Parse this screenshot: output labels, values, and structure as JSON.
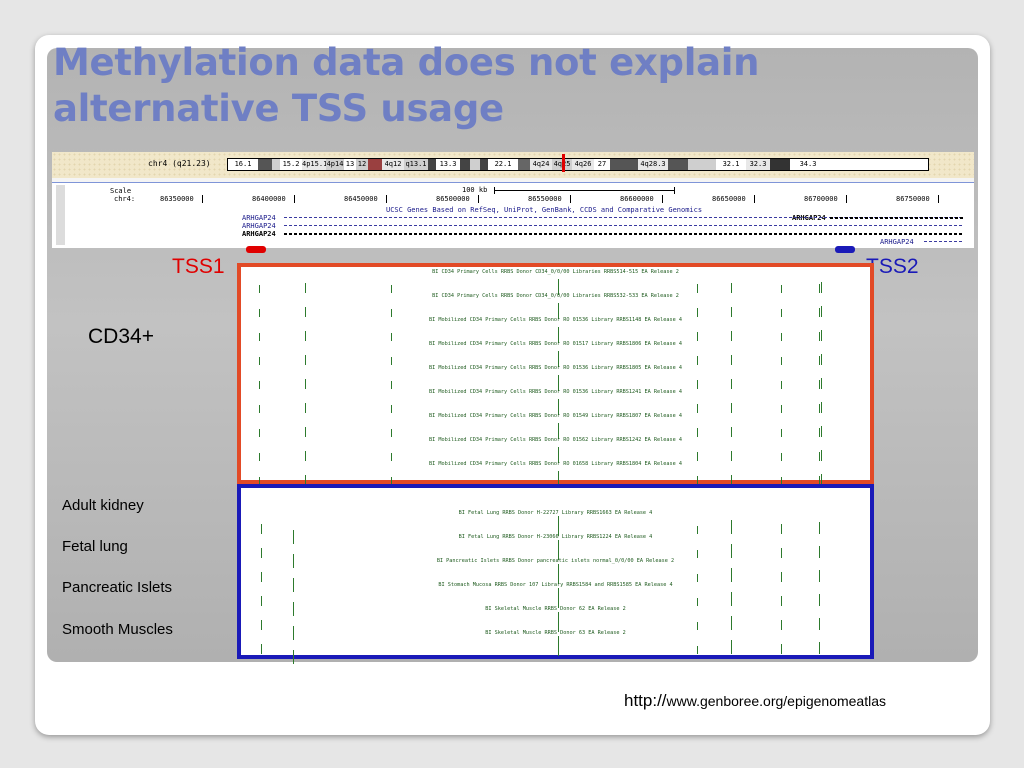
{
  "slide": {
    "title_line1": "Methylation data does not explain",
    "title_line2": "alternative TSS usage",
    "url_proto": "http://",
    "url_rest": "www.genboree.org/epigenomeatlas"
  },
  "browser": {
    "chrom_label": "chr4 (q21.23)",
    "bands": [
      {
        "label": "16.1",
        "color": "#ffffff"
      },
      {
        "label": "",
        "color": "#555555"
      },
      {
        "label": "",
        "color": "#cfcfcf"
      },
      {
        "label": "15.2",
        "color": "#ffffff"
      },
      {
        "label": "4p15.1",
        "color": "#e8e8e8"
      },
      {
        "label": "4p14",
        "color": "#cfcfcf"
      },
      {
        "label": "13",
        "color": "#ffffff"
      },
      {
        "label": "12",
        "color": "#cfcfcf"
      },
      {
        "label": "",
        "color": "#9a4040"
      },
      {
        "label": "4q12",
        "color": "#e8e8e8"
      },
      {
        "label": "q13.1",
        "color": "#cfcfcf"
      },
      {
        "label": "",
        "color": "#444444"
      },
      {
        "label": "13.3",
        "color": "#ffffff"
      },
      {
        "label": "",
        "color": "#444444"
      },
      {
        "label": "",
        "color": "#cfcfcf"
      },
      {
        "label": "",
        "color": "#444444"
      },
      {
        "label": "22.1",
        "color": "#ffffff"
      },
      {
        "label": "",
        "color": "#666666"
      },
      {
        "label": "4q24",
        "color": "#e8e8e8"
      },
      {
        "label": "4q25",
        "color": "#cfcfcf"
      },
      {
        "label": "4q26",
        "color": "#e8e8e8"
      },
      {
        "label": "27",
        "color": "#ffffff"
      },
      {
        "label": "",
        "color": "#555555"
      },
      {
        "label": "4q28.3",
        "color": "#e8e8e8"
      },
      {
        "label": "",
        "color": "#555555"
      },
      {
        "label": "",
        "color": "#cfcfcf"
      },
      {
        "label": "32.1",
        "color": "#ffffff"
      },
      {
        "label": "32.3",
        "color": "#e8e8e8"
      },
      {
        "label": "",
        "color": "#333333"
      },
      {
        "label": "34.3",
        "color": "#ffffff"
      }
    ],
    "scale_label": "Scale",
    "chr_label": "chr4:",
    "scale_value": "100 kb",
    "coordinates": [
      "86350000",
      "86400000",
      "86450000",
      "86500000",
      "86550000",
      "86600000",
      "86650000",
      "86700000",
      "86750000"
    ],
    "track_title": "UCSC Genes Based on RefSeq, UniProt, GenBank, CCDS and Comparative Genomics",
    "gene_names": [
      "ARHGAP24",
      "ARHGAP24",
      "ARHGAP24",
      "ARHGAP24",
      "ARHGAP24"
    ]
  },
  "tss": {
    "tss1": "TSS1",
    "tss2": "TSS2",
    "tss1_color": "#e00000",
    "tss2_color": "#1a1ab8"
  },
  "cd34": {
    "label": "CD34+",
    "tracks": [
      "BI CD34 Primary Cells RRBS Donor CD34_0/0/00 Libraries RRBS514-515 EA Release 2",
      "BI CD34 Primary Cells RRBS Donor CD34_0/0/00 Libraries RRBS532-533 EA Release 2",
      "BI Mobilized CD34 Primary Cells RRBS Donor RO 01536 Library RRBS1148 EA Release 4",
      "BI Mobilized CD34 Primary Cells RRBS Donor RO 01517 Library RRBS1806 EA Release 4",
      "BI Mobilized CD34 Primary Cells RRBS Donor RO 01536 Library RRBS1805 EA Release 4",
      "BI Mobilized CD34 Primary Cells RRBS Donor RO 01536 Library RRBS1241 EA Release 4",
      "BI Mobilized CD34 Primary Cells RRBS Donor RO 01549 Library RRBS1807 EA Release 4",
      "BI Mobilized CD34 Primary Cells RRBS Donor RO 01562 Library RRBS1242 EA Release 4",
      "BI Mobilized CD34 Primary Cells RRBS Donor RO 01658 Library RRBS1804 EA Release 4"
    ]
  },
  "tissues": {
    "labels": [
      "Adult kidney",
      "Fetal lung",
      "Pancreatic Islets",
      "Smooth Muscles"
    ],
    "tracks": [
      "BI Fetal Lung RRBS Donor H-22727 Library RRBS1663 EA Release 4",
      "BI Fetal Lung RRBS Donor H-23066 Library RRBS1224 EA Release 4",
      "BI Pancreatic Islets RRBS Donor pancreatic islets normal_0/0/00 EA Release 2",
      "BI Stomach Mucosa RRBS Donor 107 Library RRBS1584 and RRBS1585 EA Release 4",
      "BI Skeletal Muscle RRBS Donor 62 EA Release 2",
      "BI Skeletal Muscle RRBS Donor 63 EA Release 2"
    ]
  }
}
